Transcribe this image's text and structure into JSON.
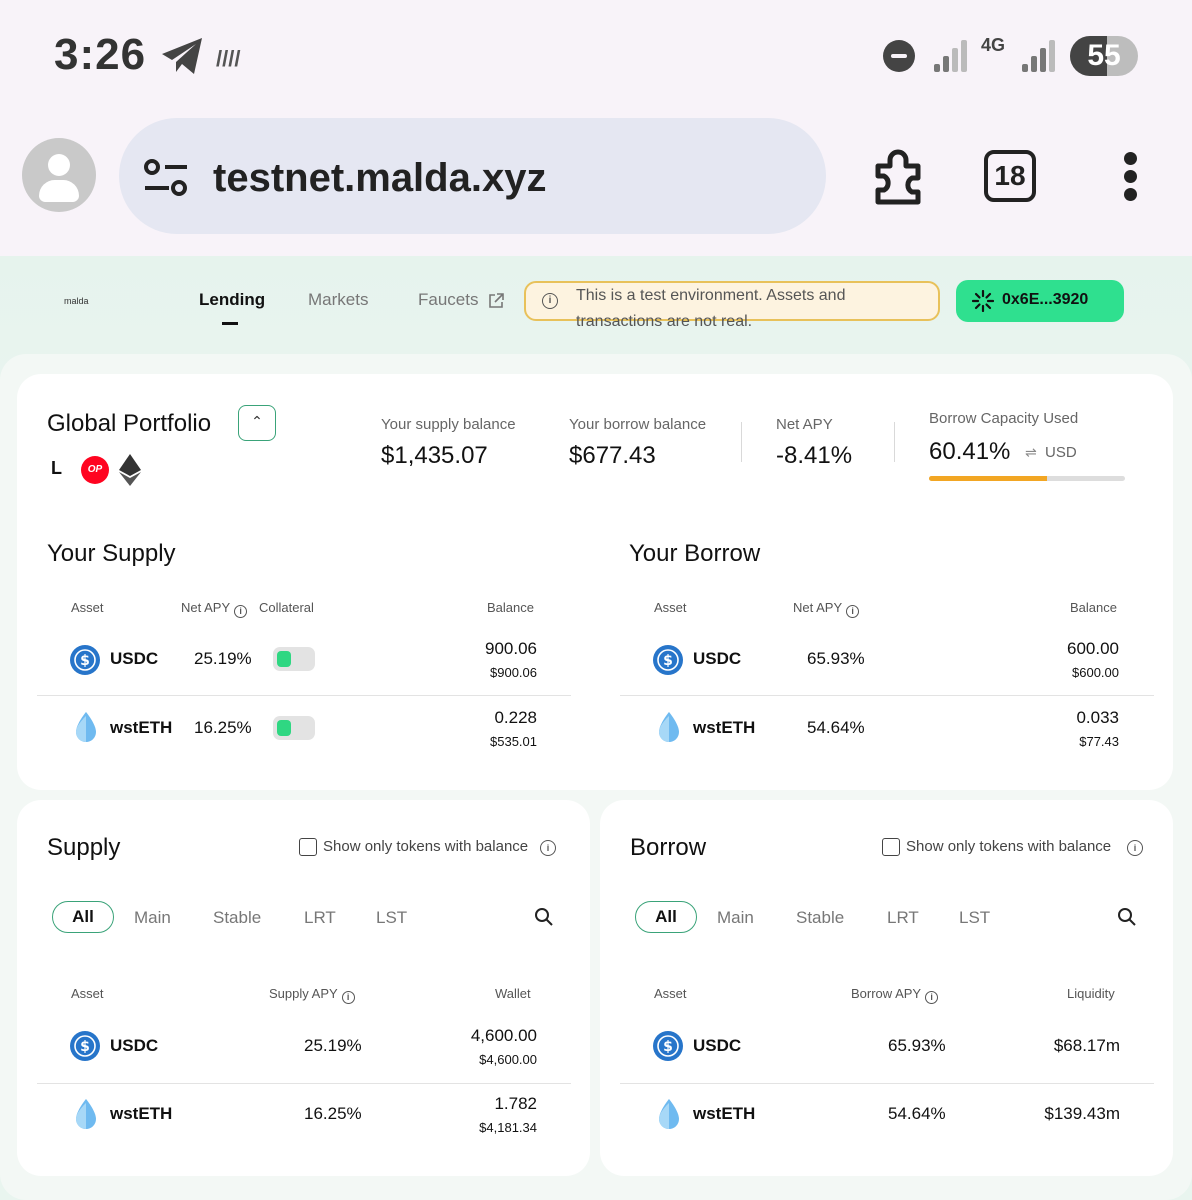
{
  "status_bar": {
    "time": "3:26",
    "network": "4G",
    "battery": 55
  },
  "browser": {
    "url": "testnet.malda.xyz",
    "tab_count": "18"
  },
  "nav": {
    "logo": "malda",
    "items": [
      "Lending",
      "Markets",
      "Faucets"
    ],
    "notice": "This is a test environment. Assets and transactions are not real.",
    "wallet": "0x6E...3920"
  },
  "portfolio": {
    "title": "Global Portfolio",
    "supply_label": "Your supply balance",
    "supply_value": "$1,435.07",
    "borrow_label": "Your borrow balance",
    "borrow_value": "$677.43",
    "apy_label": "Net APY",
    "apy_value": "-8.41%",
    "capacity_label": "Borrow Capacity Used",
    "capacity_value": "60.41%",
    "capacity_fraction": 0.6041,
    "capacity_unit": "USD",
    "chain_l": "L"
  },
  "your_supply": {
    "title": "Your Supply",
    "headers": {
      "asset": "Asset",
      "apy": "Net APY",
      "collateral": "Collateral",
      "balance": "Balance"
    },
    "rows": [
      {
        "asset": "USDC",
        "apy": "25.19%",
        "amount": "900.06",
        "usd": "$900.06"
      },
      {
        "asset": "wstETH",
        "apy": "16.25%",
        "amount": "0.228",
        "usd": "$535.01"
      }
    ]
  },
  "your_borrow": {
    "title": "Your Borrow",
    "headers": {
      "asset": "Asset",
      "apy": "Net APY",
      "balance": "Balance"
    },
    "rows": [
      {
        "asset": "USDC",
        "apy": "65.93%",
        "amount": "600.00",
        "usd": "$600.00"
      },
      {
        "asset": "wstETH",
        "apy": "54.64%",
        "amount": "0.033",
        "usd": "$77.43"
      }
    ]
  },
  "supply": {
    "title": "Supply",
    "checkbox_label": "Show only tokens with balance",
    "filters": [
      "All",
      "Main",
      "Stable",
      "LRT",
      "LST"
    ],
    "headers": {
      "asset": "Asset",
      "apy": "Supply APY",
      "wallet": "Wallet"
    },
    "rows": [
      {
        "asset": "USDC",
        "apy": "25.19%",
        "amount": "4,600.00",
        "usd": "$4,600.00"
      },
      {
        "asset": "wstETH",
        "apy": "16.25%",
        "amount": "1.782",
        "usd": "$4,181.34"
      }
    ]
  },
  "borrow": {
    "title": "Borrow",
    "checkbox_label": "Show only tokens with balance",
    "filters": [
      "All",
      "Main",
      "Stable",
      "LRT",
      "LST"
    ],
    "headers": {
      "asset": "Asset",
      "apy": "Borrow APY",
      "liquidity": "Liquidity"
    },
    "rows": [
      {
        "asset": "USDC",
        "apy": "65.93%",
        "liquidity": "$68.17m"
      },
      {
        "asset": "wstETH",
        "apy": "54.64%",
        "liquidity": "$139.43m"
      }
    ]
  },
  "colors": {
    "accent": "#2fe08f",
    "warning": "#f2a623",
    "usdc": "#2775ca"
  }
}
